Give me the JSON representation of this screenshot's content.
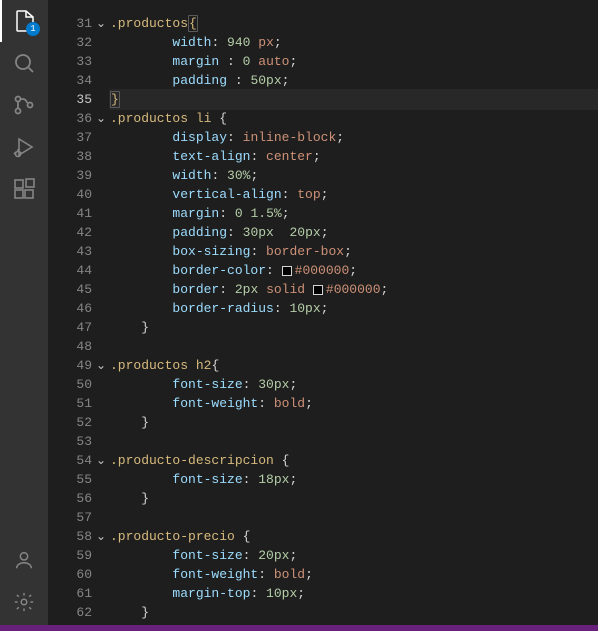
{
  "activity_badge": "1",
  "lines": [
    {
      "n": "31",
      "fold": true,
      "segs": [
        [
          "sel",
          ".productos"
        ],
        [
          "match",
          "{"
        ]
      ]
    },
    {
      "n": "32",
      "segs": [
        [
          "ind",
          2
        ],
        [
          "prop",
          "width"
        ],
        [
          "punc",
          ": "
        ],
        [
          "num",
          "940"
        ],
        [
          "punc",
          " "
        ],
        [
          "val",
          "px"
        ],
        [
          "punc",
          ";"
        ]
      ]
    },
    {
      "n": "33",
      "segs": [
        [
          "ind",
          2
        ],
        [
          "prop",
          "margin"
        ],
        [
          "punc",
          " : "
        ],
        [
          "num",
          "0"
        ],
        [
          "punc",
          " "
        ],
        [
          "val",
          "auto"
        ],
        [
          "punc",
          ";"
        ]
      ]
    },
    {
      "n": "34",
      "segs": [
        [
          "ind",
          2
        ],
        [
          "prop",
          "padding"
        ],
        [
          "punc",
          " : "
        ],
        [
          "num",
          "50px"
        ],
        [
          "punc",
          ";"
        ]
      ]
    },
    {
      "n": "35",
      "current": true,
      "hl": true,
      "segs": [
        [
          "match",
          "}"
        ]
      ]
    },
    {
      "n": "36",
      "fold": true,
      "segs": [
        [
          "sel",
          ".productos"
        ],
        [
          "punc",
          " "
        ],
        [
          "sel",
          "li"
        ],
        [
          "punc",
          " {"
        ]
      ]
    },
    {
      "n": "37",
      "segs": [
        [
          "ind",
          2
        ],
        [
          "prop",
          "display"
        ],
        [
          "punc",
          ": "
        ],
        [
          "val",
          "inline-block"
        ],
        [
          "punc",
          ";"
        ]
      ]
    },
    {
      "n": "38",
      "segs": [
        [
          "ind",
          2
        ],
        [
          "prop",
          "text-align"
        ],
        [
          "punc",
          ": "
        ],
        [
          "val",
          "center"
        ],
        [
          "punc",
          ";"
        ]
      ]
    },
    {
      "n": "39",
      "segs": [
        [
          "ind",
          2
        ],
        [
          "prop",
          "width"
        ],
        [
          "punc",
          ": "
        ],
        [
          "num",
          "30%"
        ],
        [
          "punc",
          ";"
        ]
      ]
    },
    {
      "n": "40",
      "segs": [
        [
          "ind",
          2
        ],
        [
          "prop",
          "vertical-align"
        ],
        [
          "punc",
          ": "
        ],
        [
          "val",
          "top"
        ],
        [
          "punc",
          ";"
        ]
      ]
    },
    {
      "n": "41",
      "segs": [
        [
          "ind",
          2
        ],
        [
          "prop",
          "margin"
        ],
        [
          "punc",
          ": "
        ],
        [
          "num",
          "0"
        ],
        [
          "punc",
          " "
        ],
        [
          "num",
          "1.5%"
        ],
        [
          "punc",
          ";"
        ]
      ]
    },
    {
      "n": "42",
      "segs": [
        [
          "ind",
          2
        ],
        [
          "prop",
          "padding"
        ],
        [
          "punc",
          ": "
        ],
        [
          "num",
          "30px"
        ],
        [
          "punc",
          "  "
        ],
        [
          "num",
          "20px"
        ],
        [
          "punc",
          ";"
        ]
      ]
    },
    {
      "n": "43",
      "segs": [
        [
          "ind",
          2
        ],
        [
          "prop",
          "box-sizing"
        ],
        [
          "punc",
          ": "
        ],
        [
          "val",
          "border-box"
        ],
        [
          "punc",
          ";"
        ]
      ]
    },
    {
      "n": "44",
      "segs": [
        [
          "ind",
          2
        ],
        [
          "prop",
          "border-color"
        ],
        [
          "punc",
          ": "
        ],
        [
          "color",
          ""
        ],
        [
          "val",
          "#000000"
        ],
        [
          "punc",
          ";"
        ]
      ]
    },
    {
      "n": "45",
      "segs": [
        [
          "ind",
          2
        ],
        [
          "prop",
          "border"
        ],
        [
          "punc",
          ": "
        ],
        [
          "num",
          "2px"
        ],
        [
          "punc",
          " "
        ],
        [
          "val",
          "solid"
        ],
        [
          "punc",
          " "
        ],
        [
          "color",
          ""
        ],
        [
          "val",
          "#000000"
        ],
        [
          "punc",
          ";"
        ]
      ]
    },
    {
      "n": "46",
      "segs": [
        [
          "ind",
          2
        ],
        [
          "prop",
          "border-radius"
        ],
        [
          "punc",
          ": "
        ],
        [
          "num",
          "10px"
        ],
        [
          "punc",
          ";"
        ]
      ]
    },
    {
      "n": "47",
      "segs": [
        [
          "ind",
          1
        ],
        [
          "punc",
          "}"
        ]
      ]
    },
    {
      "n": "48",
      "segs": []
    },
    {
      "n": "49",
      "fold": true,
      "segs": [
        [
          "sel",
          ".productos"
        ],
        [
          "punc",
          " "
        ],
        [
          "sel",
          "h2"
        ],
        [
          "punc",
          "{"
        ]
      ]
    },
    {
      "n": "50",
      "segs": [
        [
          "ind",
          2
        ],
        [
          "prop",
          "font-size"
        ],
        [
          "punc",
          ": "
        ],
        [
          "num",
          "30px"
        ],
        [
          "punc",
          ";"
        ]
      ]
    },
    {
      "n": "51",
      "segs": [
        [
          "ind",
          2
        ],
        [
          "prop",
          "font-weight"
        ],
        [
          "punc",
          ": "
        ],
        [
          "val",
          "bold"
        ],
        [
          "punc",
          ";"
        ]
      ]
    },
    {
      "n": "52",
      "segs": [
        [
          "ind",
          1
        ],
        [
          "punc",
          "}"
        ]
      ]
    },
    {
      "n": "53",
      "segs": []
    },
    {
      "n": "54",
      "fold": true,
      "segs": [
        [
          "sel",
          ".producto-descripcion"
        ],
        [
          "punc",
          " {"
        ]
      ]
    },
    {
      "n": "55",
      "segs": [
        [
          "ind",
          2
        ],
        [
          "prop",
          "font-size"
        ],
        [
          "punc",
          ": "
        ],
        [
          "num",
          "18px"
        ],
        [
          "punc",
          ";"
        ]
      ]
    },
    {
      "n": "56",
      "segs": [
        [
          "ind",
          1
        ],
        [
          "punc",
          "}"
        ]
      ]
    },
    {
      "n": "57",
      "segs": []
    },
    {
      "n": "58",
      "fold": true,
      "segs": [
        [
          "sel",
          ".producto-precio"
        ],
        [
          "punc",
          " {"
        ]
      ]
    },
    {
      "n": "59",
      "segs": [
        [
          "ind",
          2
        ],
        [
          "prop",
          "font-size"
        ],
        [
          "punc",
          ": "
        ],
        [
          "num",
          "20px"
        ],
        [
          "punc",
          ";"
        ]
      ]
    },
    {
      "n": "60",
      "segs": [
        [
          "ind",
          2
        ],
        [
          "prop",
          "font-weight"
        ],
        [
          "punc",
          ": "
        ],
        [
          "val",
          "bold"
        ],
        [
          "punc",
          ";"
        ]
      ]
    },
    {
      "n": "61",
      "segs": [
        [
          "ind",
          2
        ],
        [
          "prop",
          "margin-top"
        ],
        [
          "punc",
          ": "
        ],
        [
          "num",
          "10px"
        ],
        [
          "punc",
          ";"
        ]
      ]
    },
    {
      "n": "62",
      "segs": [
        [
          "ind",
          1
        ],
        [
          "punc",
          "}"
        ]
      ]
    }
  ]
}
